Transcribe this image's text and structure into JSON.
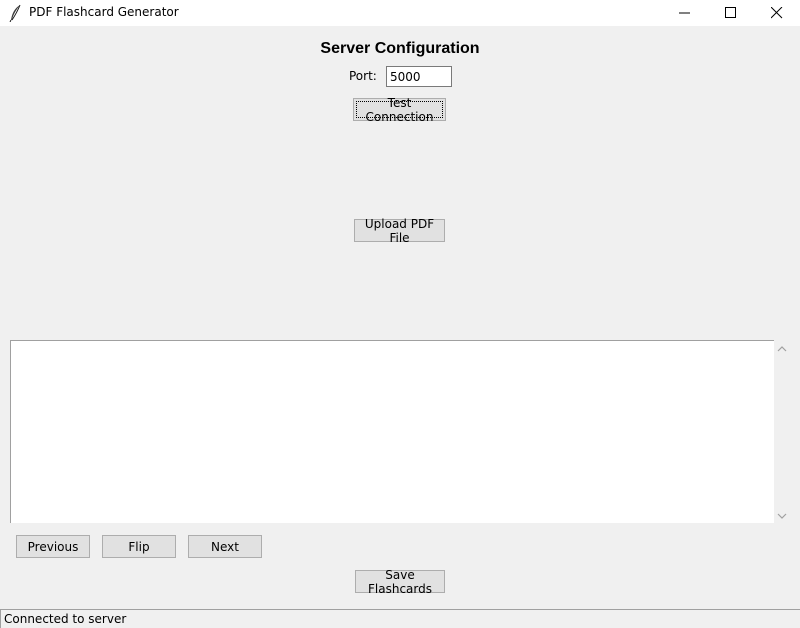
{
  "window": {
    "title": "PDF Flashcard Generator",
    "icon": "feather-icon",
    "controls": [
      "minimize-icon",
      "maximize-icon",
      "close-icon"
    ]
  },
  "server": {
    "heading": "Server Configuration",
    "port_label": "Port:",
    "port_value": "5000",
    "test_button": "Test Connection"
  },
  "upload": {
    "button": "Upload PDF File"
  },
  "flashcard": {
    "text": "",
    "scroll_icons": [
      "scroll-up-arrow-icon",
      "scroll-down-arrow-icon"
    ]
  },
  "navigation": {
    "previous": "Previous",
    "flip": "Flip",
    "next": "Next"
  },
  "save": {
    "button": "Save Flashcards"
  },
  "status": {
    "text": "Connected to server"
  }
}
